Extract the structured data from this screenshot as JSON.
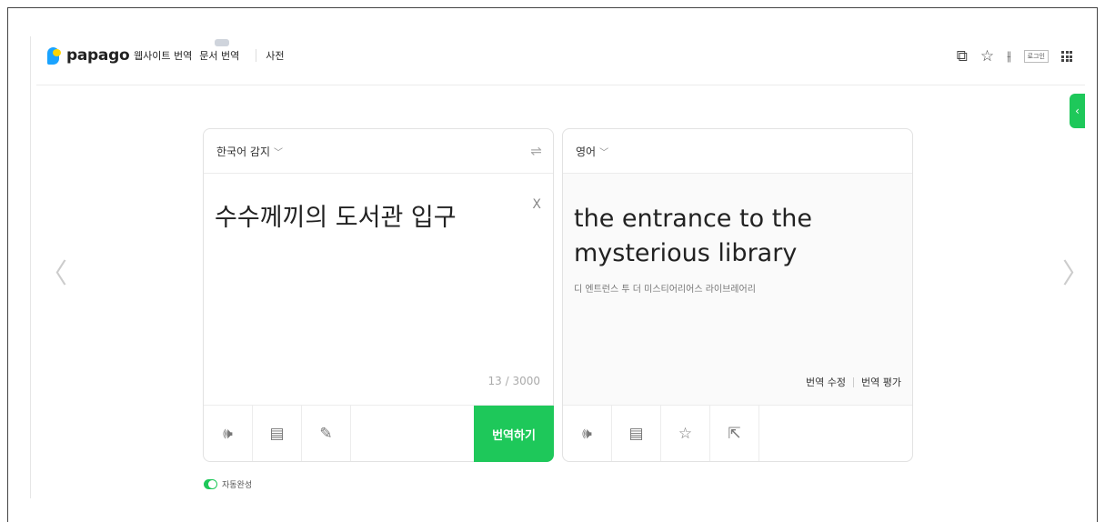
{
  "header": {
    "logo_text": "papago",
    "nav": {
      "website": "웹사이트 번역",
      "document": "문서 번역",
      "dictionary": "사전"
    },
    "login_label": "로그인"
  },
  "source": {
    "language": "한국어 감지",
    "text": "수수께끼의 도서관 입구",
    "char_count": "13 / 3000",
    "translate_label": "번역하기"
  },
  "target": {
    "language": "영어",
    "text": "the entrance to the mysterious library",
    "pronunciation": "디 엔트런스 투 더 미스티어리어스 라이브레어리",
    "edit_label": "번역 수정",
    "rate_label": "번역 평가"
  },
  "autocomplete_label": "자동완성",
  "colors": {
    "accent": "#1ec85a"
  },
  "icons": [
    "speaker-icon",
    "document-icon",
    "handwriting-icon",
    "star-icon",
    "share-icon",
    "swap-icon",
    "close-icon",
    "grid-icon",
    "settings-icon",
    "bookmark-icon",
    "external-icon"
  ]
}
